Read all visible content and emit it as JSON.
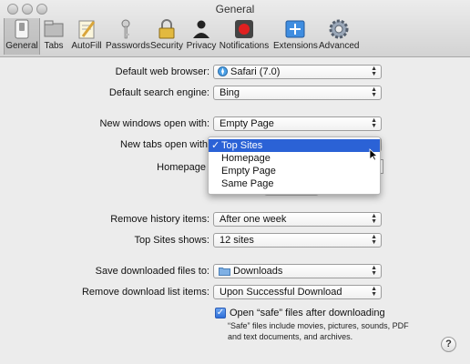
{
  "window": {
    "title": "General"
  },
  "toolbar": {
    "items": [
      {
        "label": "General",
        "icon": "general-switch-icon"
      },
      {
        "label": "Tabs",
        "icon": "tabs-icon"
      },
      {
        "label": "AutoFill",
        "icon": "pencil-paper-icon"
      },
      {
        "label": "Passwords",
        "icon": "key-icon"
      },
      {
        "label": "Security",
        "icon": "padlock-icon"
      },
      {
        "label": "Privacy",
        "icon": "silhouette-icon"
      },
      {
        "label": "Notifications",
        "icon": "notification-red-dot-icon"
      },
      {
        "label": "Extensions",
        "icon": "puzzle-icon"
      },
      {
        "label": "Advanced",
        "icon": "gear-icon"
      }
    ]
  },
  "form": {
    "default_browser": {
      "label": "Default web browser:",
      "value": "Safari (7.0)"
    },
    "search_engine": {
      "label": "Default search engine:",
      "value": "Bing"
    },
    "new_windows": {
      "label": "New windows open with:",
      "value": "Empty Page"
    },
    "new_tabs": {
      "label": "New tabs open with"
    },
    "homepage": {
      "label": "Homepage"
    },
    "remove_history": {
      "label": "Remove history items:",
      "value": "After one week"
    },
    "top_sites": {
      "label": "Top Sites shows:",
      "value": "12 sites"
    },
    "save_downloads": {
      "label": "Save downloaded files to:",
      "value": "Downloads",
      "icon": "folder-icon"
    },
    "remove_downloads": {
      "label": "Remove download list items:",
      "value": "Upon Successful Download"
    },
    "open_safe": {
      "label": "Open “safe” files after downloading",
      "checked": true,
      "note": "“Safe” files include movies, pictures, sounds, PDF and text documents, and archives."
    }
  },
  "dropdown_menu": {
    "items": [
      {
        "label": "Top Sites",
        "selected": true,
        "check": "✓"
      },
      {
        "label": "Homepage",
        "selected": false
      },
      {
        "label": "Empty Page",
        "selected": false
      },
      {
        "label": "Same Page",
        "selected": false
      }
    ]
  },
  "help": {
    "label": "?"
  },
  "colors": {
    "accent": "#2b62d6",
    "window_bg": "#ececec"
  }
}
